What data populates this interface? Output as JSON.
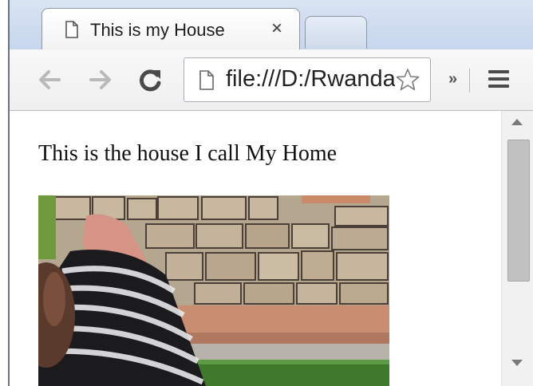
{
  "tab": {
    "title": "This is my House",
    "close_glyph": "×"
  },
  "toolbar": {
    "back_icon": "back-arrow-icon",
    "forward_icon": "forward-arrow-icon",
    "reload_icon": "reload-icon",
    "url": "file:///D:/Rwanda",
    "overflow_glyph": "»",
    "menu_icon": "hamburger-menu-icon"
  },
  "page": {
    "heading": "This is the house I call My Home",
    "image_subject": "house-photo"
  },
  "colors": {
    "frame": "#cfdcef",
    "toolbar": "#f2f2f2",
    "wall_stone": "#b7a68e",
    "grass": "#3f7a2c"
  }
}
